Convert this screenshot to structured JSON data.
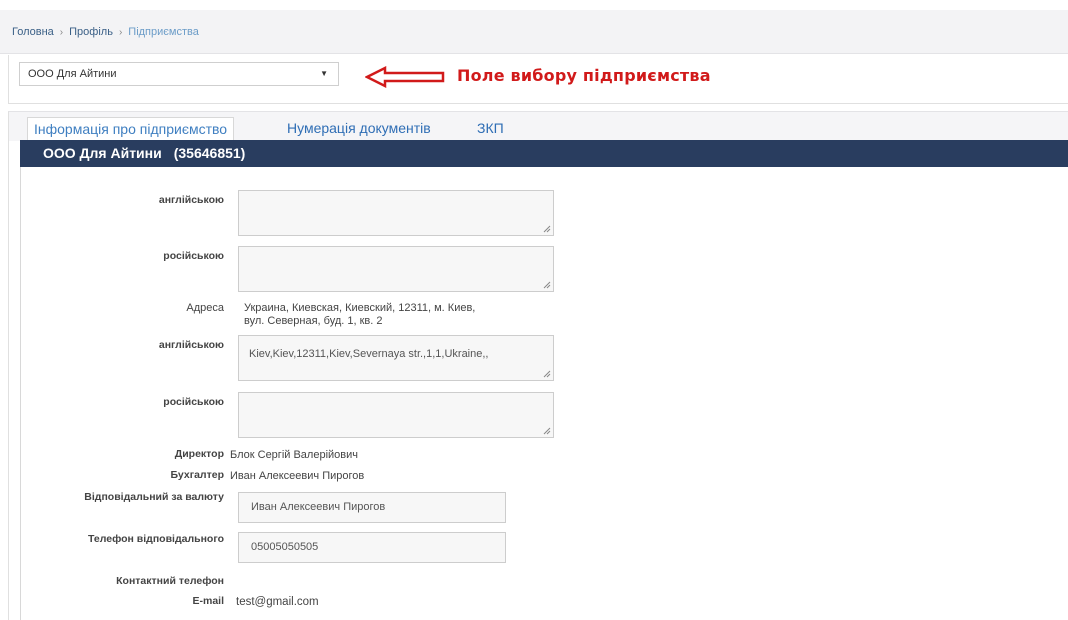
{
  "breadcrumb": {
    "home": "Головна",
    "profile": "Профіль",
    "current": "Підприємства",
    "separator": "›"
  },
  "selector": {
    "value": "ООО Для Айтини",
    "caret": "▼"
  },
  "annotation": {
    "text": "Поле вибору підприємства",
    "color": "#d11a1a"
  },
  "tabs": [
    {
      "label": "Інформація про підприємство",
      "active": true
    },
    {
      "label": "Нумерація документів",
      "active": false
    },
    {
      "label": "ЗКП",
      "active": false
    }
  ],
  "company": {
    "name": "ООО Для Айтини",
    "code": "(35646851)"
  },
  "form": {
    "name_en_label": "англійською",
    "name_en_value": "",
    "name_ru_label": "російською",
    "name_ru_value": "",
    "address_label": "Адреса",
    "address_line1": "Украина, Киевская, Киевский, 12311, м. Киев,",
    "address_line2": "вул. Северная, буд. 1, кв. 2",
    "address_en_label": "англійською",
    "address_en_value": "Kiev,Kiev,12311,Kiev,Severnaya str.,1,1,Ukraine,,",
    "address_ru_label": "російською",
    "address_ru_value": "",
    "director_label": "Директор",
    "director_value": "Блок Сергій Валерійович",
    "accountant_label": "Бухгалтер",
    "accountant_value": "Иван Алексеевич Пирогов",
    "currency_resp_label": "Відповідальний за валюту",
    "currency_resp_value": "Иван Алексеевич Пирогов",
    "resp_phone_label": "Телефон відповідального",
    "resp_phone_value": "05005050505",
    "contact_phone_label": "Контактний телефон",
    "email_label": "E-mail",
    "email_value": "test@gmail.com"
  },
  "colors": {
    "header_bar": "#293d5f",
    "link": "#2f6eb5",
    "arrow": "#d11a1a"
  }
}
